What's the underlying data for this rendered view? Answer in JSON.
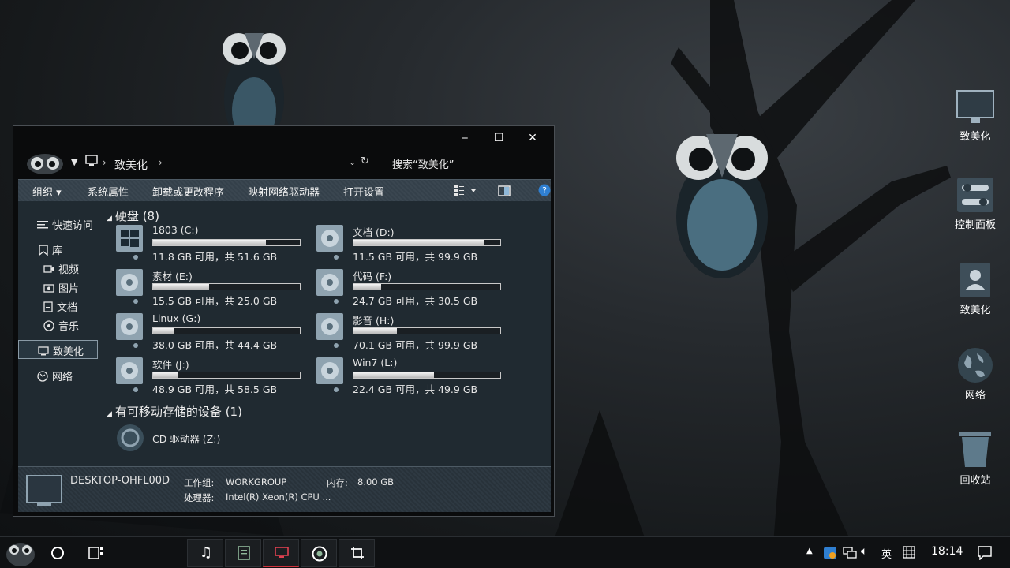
{
  "desktop": {
    "icons": [
      {
        "label": "致美化",
        "icon": "computer-icon"
      },
      {
        "label": "控制面板",
        "icon": "control-panel-icon"
      },
      {
        "label": "致美化",
        "icon": "user-folder-icon"
      },
      {
        "label": "网络",
        "icon": "network-globe-icon"
      },
      {
        "label": "回收站",
        "icon": "recycle-bin-icon"
      }
    ]
  },
  "window": {
    "controls": {
      "minimize": "‒",
      "maximize": "☐",
      "close": "✕"
    },
    "address": {
      "current": "致美化",
      "search_placeholder": "搜索“致美化”"
    },
    "toolbar": {
      "organize": "组织 ▾",
      "system_properties": "系统属性",
      "uninstall": "卸载或更改程序",
      "map_drive": "映射网络驱动器",
      "open_settings": "打开设置"
    },
    "nav": {
      "quick_access": "快速访问",
      "library": "库",
      "videos": "视频",
      "pictures": "图片",
      "documents": "文档",
      "music": "音乐",
      "this_pc": "致美化",
      "network": "网络"
    },
    "groups": {
      "hard_disks": "硬盘 (8)",
      "removable": "有可移动存储的设备 (1)"
    },
    "drives": [
      {
        "name": "1803 (C:)",
        "free_text": "11.8 GB 可用，共 51.6 GB",
        "used_fraction": 0.771
      },
      {
        "name": "文档 (D:)",
        "free_text": "11.5 GB 可用，共 99.9 GB",
        "used_fraction": 0.885
      },
      {
        "name": "素材 (E:)",
        "free_text": "15.5 GB 可用，共 25.0 GB",
        "used_fraction": 0.38
      },
      {
        "name": "代码 (F:)",
        "free_text": "24.7 GB 可用，共 30.5 GB",
        "used_fraction": 0.19
      },
      {
        "name": "Linux (G:)",
        "free_text": "38.0 GB 可用，共 44.4 GB",
        "used_fraction": 0.144
      },
      {
        "name": "影音 (H:)",
        "free_text": "70.1 GB 可用，共 99.9 GB",
        "used_fraction": 0.298
      },
      {
        "name": "软件 (J:)",
        "free_text": "48.9 GB 可用，共 58.5 GB",
        "used_fraction": 0.164
      },
      {
        "name": "Win7 (L:)",
        "free_text": "22.4 GB 可用，共 49.9 GB",
        "used_fraction": 0.551
      }
    ],
    "cd_drive": "CD 驱动器 (Z:)",
    "status": {
      "computer_name": "DESKTOP-OHFL00D",
      "workgroup_label": "工作组:",
      "workgroup_value": "WORKGROUP",
      "memory_label": "内存:",
      "memory_value": "8.00 GB",
      "cpu_label": "处理器:",
      "cpu_value": "Intel(R) Xeon(R) CPU ..."
    }
  },
  "taskbar": {
    "ime": "英",
    "clock": "18:14"
  },
  "colors": {
    "accent": "#8fa3b0",
    "toolbar_bg": "#3a4650",
    "content_bg": "#202a31"
  }
}
